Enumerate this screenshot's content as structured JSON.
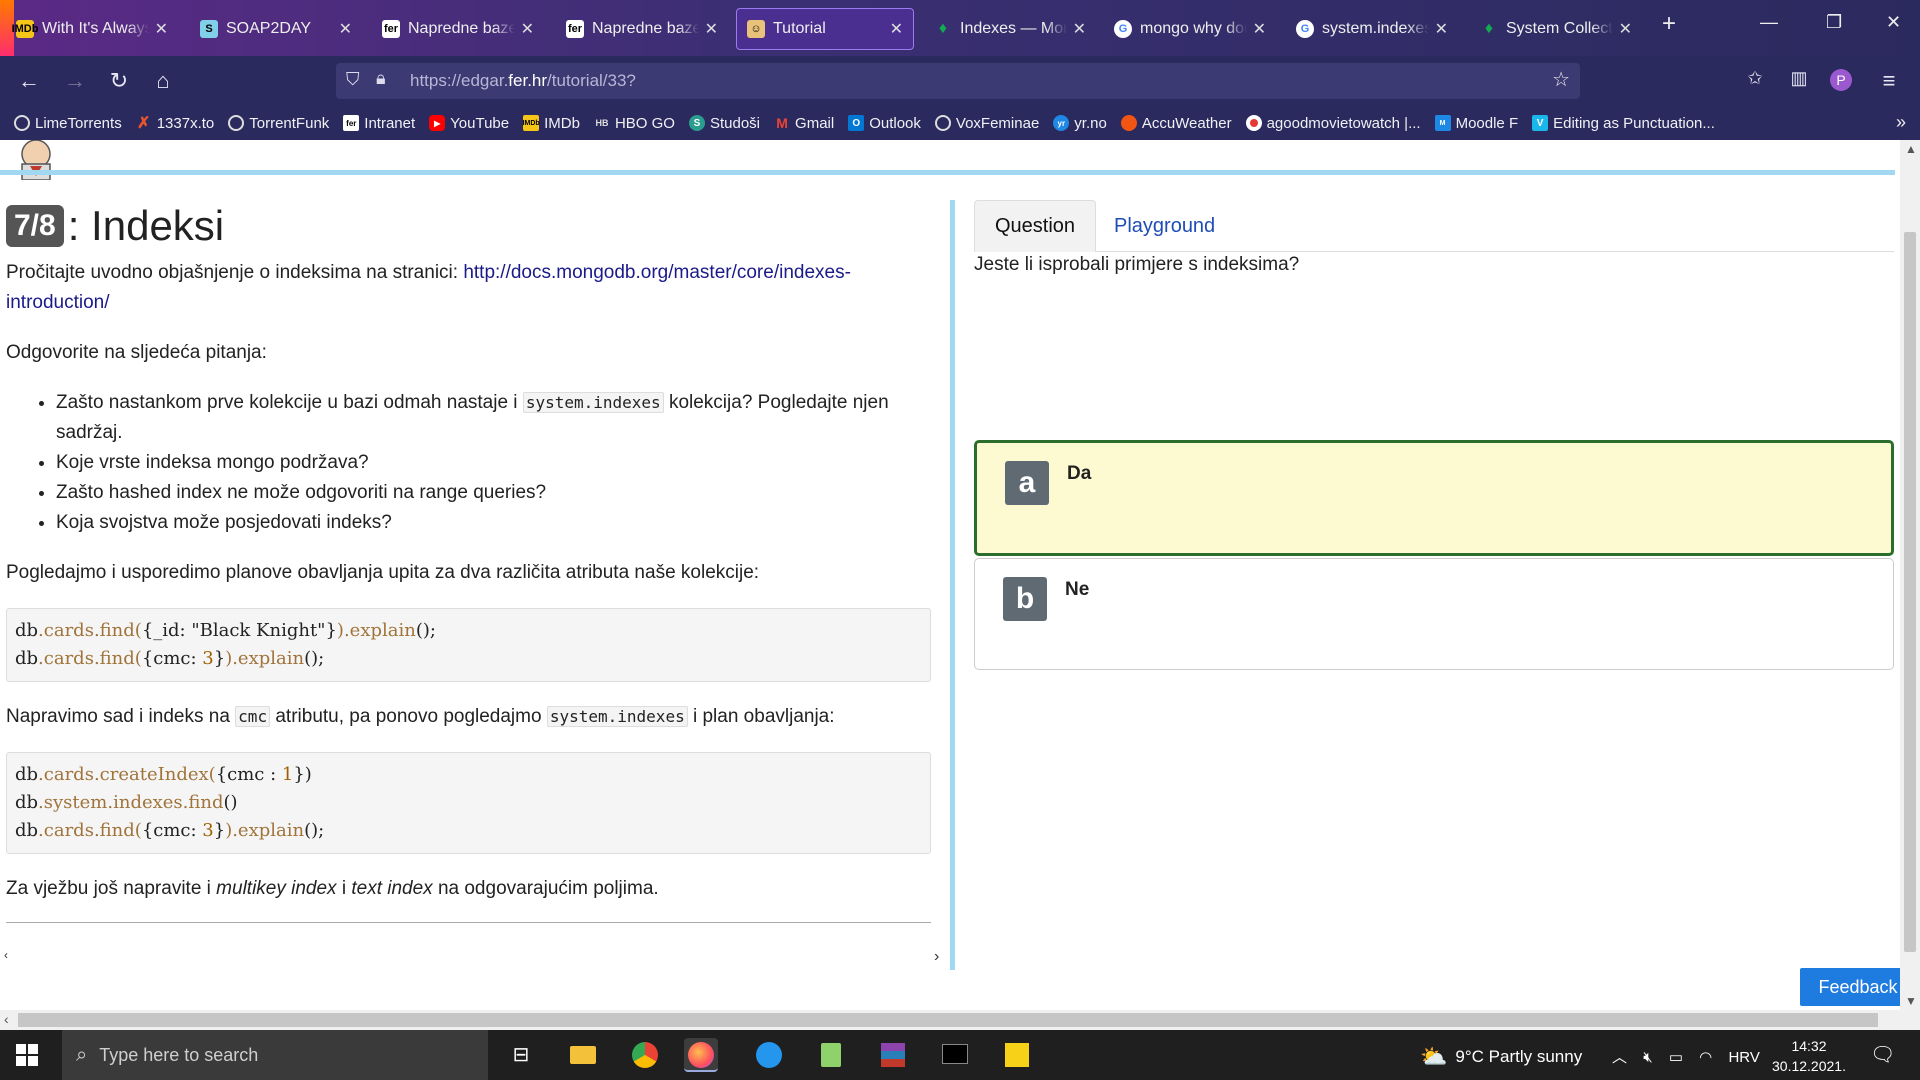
{
  "browser": {
    "tabs": [
      {
        "title": "With It's Always S",
        "favicon": "imdb-icon",
        "color": "#f5c518"
      },
      {
        "title": "SOAP2DAY",
        "favicon": "soap2day-icon",
        "color": "#7fd0e8"
      },
      {
        "title": "Napredne baze p",
        "favicon": "fer-icon",
        "color": "#000000"
      },
      {
        "title": "Napredne baze p",
        "favicon": "fer-icon",
        "color": "#000000"
      },
      {
        "title": "Tutorial",
        "favicon": "tutorial-icon",
        "color": "#e8c27a",
        "active": true
      },
      {
        "title": "Indexes — Mong",
        "favicon": "mongodb-leaf-icon",
        "color": "#13aa52"
      },
      {
        "title": "mongo why don't",
        "favicon": "google-icon",
        "color": "#ffffff"
      },
      {
        "title": "system.indexes m",
        "favicon": "google-icon",
        "color": "#ffffff"
      },
      {
        "title": "System Collectio",
        "favicon": "mongodb-leaf-icon",
        "color": "#13aa52"
      }
    ],
    "new_tab": "+",
    "url": {
      "prefix": "https://edgar.",
      "domain": "fer.hr",
      "path": "/tutorial/33?"
    },
    "bookmarks": [
      {
        "label": "LimeTorrents",
        "icon": "globe-icon",
        "color": "#888888"
      },
      {
        "label": "1337x.to",
        "icon": "x-icon",
        "color": "#e8542c"
      },
      {
        "label": "TorrentFunk",
        "icon": "gear-icon",
        "color": "#888888"
      },
      {
        "label": "Intranet",
        "icon": "fer-icon",
        "color": "#000000"
      },
      {
        "label": "YouTube",
        "icon": "youtube-icon",
        "color": "#ff0000"
      },
      {
        "label": "IMDb",
        "icon": "imdb-icon",
        "color": "#f5c518"
      },
      {
        "label": "HBO GO",
        "icon": "hbo-icon",
        "color": "#888888"
      },
      {
        "label": "Studoši",
        "icon": "studosi-icon",
        "color": "#2a9d8f"
      },
      {
        "label": "Gmail",
        "icon": "gmail-icon",
        "color": "#ea4335"
      },
      {
        "label": "Outlook",
        "icon": "outlook-icon",
        "color": "#0078d4"
      },
      {
        "label": "VoxFeminae",
        "icon": "globe-icon",
        "color": "#888888"
      },
      {
        "label": "yr.no",
        "icon": "yr-icon",
        "color": "#1e88e5"
      },
      {
        "label": "AccuWeather",
        "icon": "sun-icon",
        "color": "#f05514"
      },
      {
        "label": "agoodmovietowatch |...",
        "icon": "movie-icon",
        "color": "#e53935"
      },
      {
        "label": "Moodle F",
        "icon": "moodle-icon",
        "color": "#1e88e5"
      },
      {
        "label": "Editing as Punctuation...",
        "icon": "vimeo-icon",
        "color": "#1ab7ea"
      }
    ]
  },
  "lesson": {
    "badge": "7/8",
    "title": ": Indeksi",
    "intro": "Pročitajte uvodno objašnjenje o indeksima na stranici: ",
    "link": "http://docs.mongodb.org/master/core/indexes-introduction/",
    "answer_prompt": "Odgovorite na sljedeća pitanja:",
    "q1_pre": "Zašto nastankom prve kolekcije u bazi odmah nastaje i ",
    "q1_code": "system.indexes",
    "q1_post": " kolekcija? Pogledajte njen sadržaj.",
    "q2": "Koje vrste indeksa mongo podržava?",
    "q3": "Zašto hashed index ne može odgovoriti na range queries?",
    "q4": "Koja svojstva može posjedovati indeks?",
    "compare": "Pogledajmo i usporedimo planove obavljanja upita za dva različita atributa naše kolekcije:",
    "code1_l1_a": "db",
    "code1_l1_b": ".cards.find(",
    "code1_l1_c": "{_id: \"Black Knight\"}",
    "code1_l1_d": ").explain",
    "code1_l1_e": "();",
    "code1_l2_a": "db",
    "code1_l2_b": ".cards.find(",
    "code1_l2_c": "{cmc: ",
    "code1_l2_n": "3",
    "code1_l2_d": "}",
    "code1_l2_e": ").explain",
    "code1_l2_f": "();",
    "index_pre": "Napravimo sad i indeks na ",
    "index_code1": "cmc",
    "index_mid": " atributu, pa ponovo pogledajmo ",
    "index_code2": "system.indexes",
    "index_post": " i plan obavljanja:",
    "code2_l1_a": "db",
    "code2_l1_b": ".cards.createIndex(",
    "code2_l1_c": "{cmc : ",
    "code2_l1_n": "1",
    "code2_l1_d": "})",
    "code2_l2_a": "db",
    "code2_l2_b": ".system.indexes.find",
    "code2_l2_c": "()",
    "code2_l3_a": "db",
    "code2_l3_b": ".cards.find(",
    "code2_l3_c": "{cmc: ",
    "code2_l3_n": "3",
    "code2_l3_d": "}",
    "code2_l3_e": ").explain",
    "code2_l3_f": "();",
    "exercise_pre": "Za vježbu još napravite i ",
    "exercise_em1": "multikey index",
    "exercise_mid": " i ",
    "exercise_em2": "text index",
    "exercise_post": " na odgovarajućim poljima."
  },
  "quiz": {
    "tabs": [
      "Question",
      "Playground"
    ],
    "question": "Jeste li isprobali primjere s indeksima?",
    "answers": [
      {
        "letter": "a",
        "text": "Da",
        "selected": true
      },
      {
        "letter": "b",
        "text": "Ne",
        "selected": false
      }
    ],
    "feedback": "Feedback"
  },
  "taskbar": {
    "search_placeholder": "Type here to search",
    "weather": "9°C  Partly sunny",
    "language": "HRV",
    "time": "14:32",
    "date": "30.12.2021."
  }
}
